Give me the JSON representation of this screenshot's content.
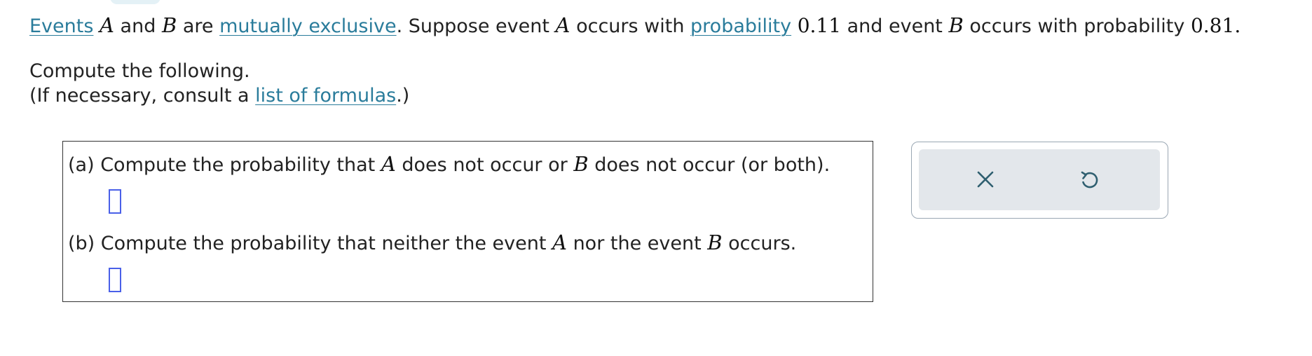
{
  "intro": {
    "events_link": "Events",
    "var_a": "A",
    "and": " and ",
    "var_b": "B",
    "are": " are ",
    "mutually_exclusive_link": "mutually exclusive",
    "suppose": ". Suppose event ",
    "occurs_with": " occurs with ",
    "probability_link": "probability",
    "p_a": "0.11",
    "and_event": " and event ",
    "occurs_with_probability": " occurs with probability ",
    "p_b": "0.81",
    "period": "."
  },
  "instructions": {
    "compute": "Compute the following.",
    "consult_prefix": "(If necessary, consult a ",
    "formulas_link": "list of formulas",
    "consult_suffix": ".)"
  },
  "question_a": {
    "prefix": "(a) Compute the probability that ",
    "var_a": "A",
    "middle": " does not occur or ",
    "var_b": "B",
    "suffix": " does not occur (or both)."
  },
  "question_b": {
    "prefix": "(b) Compute the probability that neither the event ",
    "var_a": "A",
    "middle": " nor the event ",
    "var_b": "B",
    "suffix": " occurs."
  },
  "tools": {
    "clear_icon": "x-icon",
    "undo_icon": "undo-icon"
  },
  "colors": {
    "link": "#2a7c9b",
    "answer_slot_border": "#4a60e8",
    "tool_panel_bg": "#e3e7eb",
    "tool_icon": "#2f5f70"
  }
}
